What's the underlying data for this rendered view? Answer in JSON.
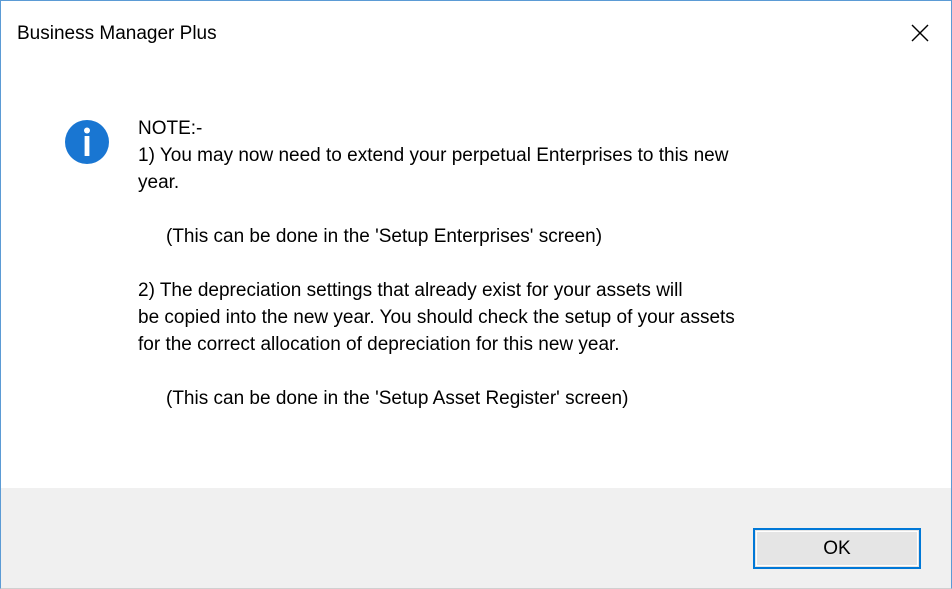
{
  "window": {
    "title": "Business Manager Plus",
    "close_icon": "close-icon"
  },
  "message": {
    "icon": "info-icon",
    "icon_color": "#1976d2",
    "lines": [
      "NOTE:-",
      "1) You may now need to extend your perpetual Enterprises to this new",
      "year.",
      "(This can be done in the 'Setup Enterprises' screen)",
      "2) The depreciation settings that already exist for your assets will",
      "be copied into the new year. You should check the setup of your assets",
      "for the correct allocation of depreciation for this new year.",
      "(This can be done in the 'Setup Asset Register' screen)"
    ]
  },
  "footer": {
    "ok_label": "OK",
    "accent": "#0078d7"
  }
}
